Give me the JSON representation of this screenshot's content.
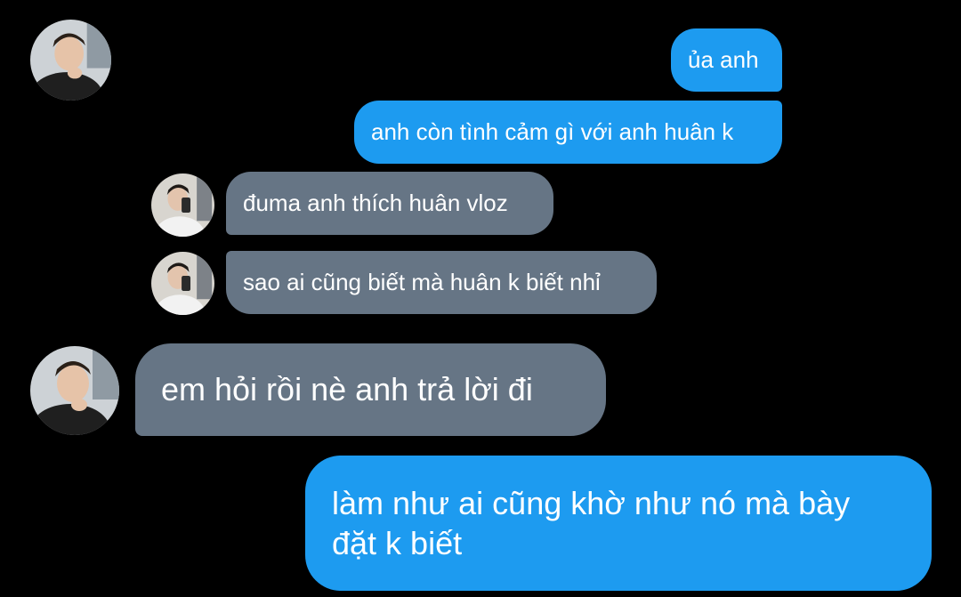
{
  "colors": {
    "background": "#000000",
    "sent_bubble": "#1d9bf0",
    "received_bubble": "#667585",
    "text": "#ffffff"
  },
  "messages": [
    {
      "side": "sent",
      "text": "ủa anh"
    },
    {
      "side": "sent",
      "text": "anh còn tình cảm gì với anh huân k"
    },
    {
      "side": "received",
      "sender": "friend",
      "text": "đuma anh thích huân vloz"
    },
    {
      "side": "received",
      "sender": "friend",
      "text": "sao ai cũng biết mà huân k biết nhỉ"
    },
    {
      "side": "received",
      "sender": "self",
      "text": "em hỏi rồi nè anh trả lời đi"
    },
    {
      "side": "sent",
      "text": "làm như ai cũng khờ như nó mà bày đặt k biết"
    }
  ]
}
